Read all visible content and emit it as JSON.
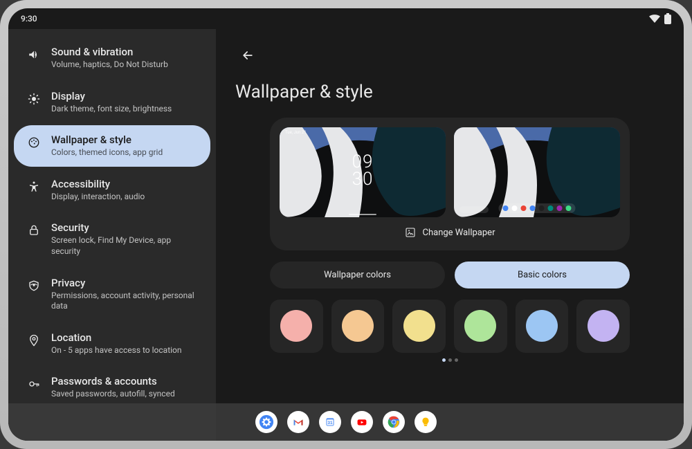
{
  "status": {
    "time": "9:30"
  },
  "sidebar": {
    "items": [
      {
        "id": "sound",
        "label": "Sound & vibration",
        "sub": "Volume, haptics, Do Not Disturb"
      },
      {
        "id": "display",
        "label": "Display",
        "sub": "Dark theme, font size, brightness"
      },
      {
        "id": "wallpaper",
        "label": "Wallpaper & style",
        "sub": "Colors, themed icons, app grid"
      },
      {
        "id": "a11y",
        "label": "Accessibility",
        "sub": "Display, interaction, audio"
      },
      {
        "id": "security",
        "label": "Security",
        "sub": "Screen lock, Find My Device, app security"
      },
      {
        "id": "privacy",
        "label": "Privacy",
        "sub": "Permissions, account activity, personal data"
      },
      {
        "id": "location",
        "label": "Location",
        "sub": "On - 5 apps have access to location"
      },
      {
        "id": "passwords",
        "label": "Passwords & accounts",
        "sub": "Saved passwords, autofill, synced"
      }
    ],
    "active_index": 2
  },
  "main": {
    "title": "Wallpaper & style",
    "preview_clock": {
      "line1": "09",
      "line2": "30"
    },
    "preview_status": "Tue, Jun 21",
    "change_label": "Change Wallpaper",
    "tabs": [
      {
        "label": "Wallpaper colors",
        "active": false
      },
      {
        "label": "Basic colors",
        "active": true
      }
    ],
    "swatches": [
      {
        "name": "pink",
        "color": "#f5b0ab"
      },
      {
        "name": "orange",
        "color": "#f5c892"
      },
      {
        "name": "yellow",
        "color": "#f2e08e"
      },
      {
        "name": "green",
        "color": "#aee59a"
      },
      {
        "name": "blue",
        "color": "#9cc6f3"
      },
      {
        "name": "purple",
        "color": "#c3b3f2"
      }
    ],
    "dock_colors": [
      "#4285f4",
      "#ffffff",
      "#ea4335",
      "#4285f4",
      "#1f1f1f",
      "#00897b",
      "#9c27b0",
      "#3ddc84"
    ],
    "pager": {
      "count": 3,
      "active": 0
    }
  },
  "taskbar": {
    "apps": [
      "settings",
      "gmail",
      "calendar",
      "youtube",
      "chrome",
      "keep"
    ]
  }
}
